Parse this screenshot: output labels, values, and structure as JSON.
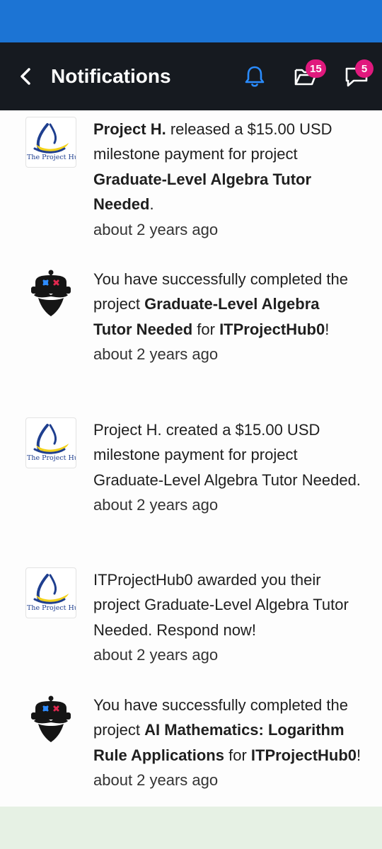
{
  "header": {
    "title": "Notifications",
    "bell_icon": "bell-icon",
    "projects_badge": "15",
    "messages_badge": "5"
  },
  "colors": {
    "status_bar": "#1c74d4",
    "app_bar": "#161a20",
    "bell_accent": "#2a8cff",
    "badge": "#e0197d"
  },
  "notifications": [
    {
      "avatar": "The Project Hul",
      "parts": [
        "Project H.",
        " released a $15.00 USD milestone payment for project ",
        "Graduate-Level Algebra Tutor Needed",
        "."
      ],
      "time": "about 2 years ago"
    },
    {
      "avatar": "robot-avatar",
      "parts": [
        "You have successfully completed the project ",
        "Graduate-Level Algebra Tutor Needed",
        " for ",
        "ITProjectHub0",
        "!"
      ],
      "time": "about 2 years ago"
    },
    {
      "avatar": "The Project Hul",
      "text": "Project H. created a $15.00 USD milestone payment for project Graduate-Level Algebra Tutor Needed.",
      "time": "about 2 years ago"
    },
    {
      "avatar": "The Project Hul",
      "text": "ITProjectHub0 awarded you their project Graduate-Level Algebra Tutor Needed. Respond now!",
      "time": "about 2 years ago"
    },
    {
      "avatar": "robot-avatar",
      "parts": [
        "You have successfully completed the project ",
        "AI Mathematics: Logarithm Rule Applications",
        " for ",
        "ITProjectHub0",
        "!"
      ],
      "time": "about 2 years ago"
    }
  ]
}
